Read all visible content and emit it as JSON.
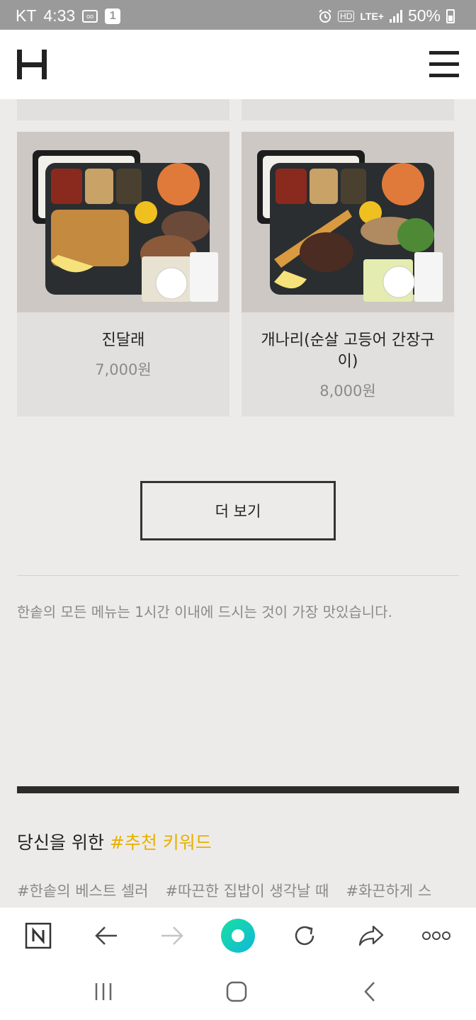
{
  "status_bar": {
    "carrier": "KT",
    "time": "4:33",
    "notif_count": "1",
    "hd": "HD",
    "network": "LTE+",
    "battery": "50%"
  },
  "header": {
    "logo_icon": "hansot-h-logo-icon",
    "menu_icon": "hamburger-menu-icon"
  },
  "products": [
    {
      "name": "진달래",
      "price": "7,000원"
    },
    {
      "name": "개나리(순살 고등어 간장구이)",
      "price": "8,000원"
    }
  ],
  "more_button": "더 보기",
  "notice": "한솥의 모든 메뉴는 1시간 이내에 드시는 것이 가장 맛있습니다.",
  "keywords": {
    "title": "당신을 위한",
    "title_accent": "#추천 키워드",
    "tags": [
      "#한솥의 베스트 셀러",
      "#따끈한 집밥이 생각날 때",
      "#화끈하게 스"
    ]
  },
  "browser_toolbar": [
    "naver-home-icon",
    "back-arrow-icon",
    "forward-arrow-icon",
    "green-dot-icon",
    "refresh-icon",
    "share-icon",
    "more-dots-icon"
  ],
  "system_nav": [
    "recent-apps-icon",
    "home-icon",
    "back-icon"
  ],
  "colors": {
    "accent": "#e8b000",
    "page_bg": "#edebea",
    "card_bg": "#e2e0df",
    "status_bar": "#9a9a9a",
    "green": "#1fd6a0"
  }
}
